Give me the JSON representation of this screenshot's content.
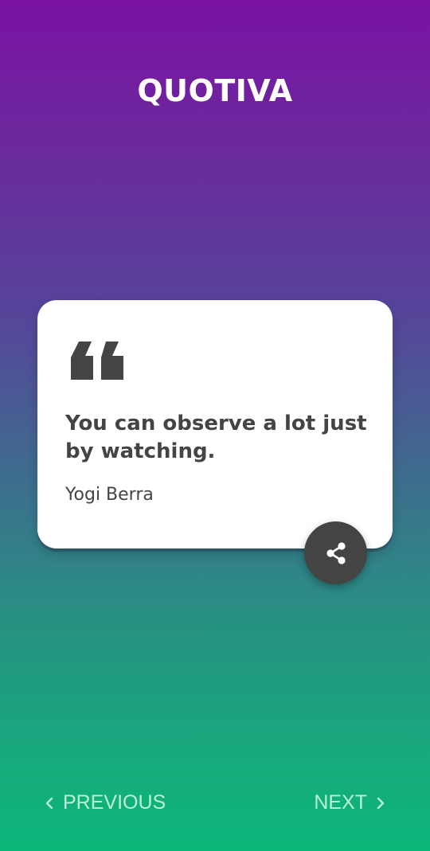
{
  "app": {
    "title": "QUOTIVA"
  },
  "quote": {
    "text": "You can observe a lot just by watching.",
    "author": "Yogi Berra",
    "icon": "quote-mark-icon"
  },
  "actions": {
    "share_icon": "share-icon"
  },
  "navigation": {
    "previous_label": "PREVIOUS",
    "next_label": "NEXT"
  },
  "colors": {
    "gradient_top": "#7a12a3",
    "gradient_bottom": "#0bb679",
    "card": "#ffffff",
    "text_dark": "#444444",
    "nav_text": "#b9f2d6"
  }
}
